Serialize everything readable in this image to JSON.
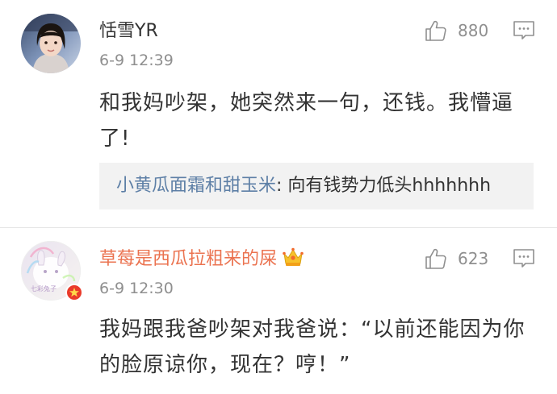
{
  "comments": [
    {
      "username": "恬雪YR",
      "time": "6-9 12:39",
      "likes": "880",
      "text": "和我妈吵架，她突然来一句，还钱。我懵逼了!",
      "reply": {
        "name": "小黄瓜面霜和甜玉米",
        "separator": ": ",
        "text": "向有钱势力低头hhhhhhh"
      }
    },
    {
      "username": "草莓是西瓜拉粗来的屎",
      "time": "6-9 12:30",
      "likes": "623",
      "text": "我妈跟我爸吵架对我爸说：“以前还能因为你的脸原谅你，现在？哼！”",
      "badge": "crown-icon",
      "avatar_text": "七彩兔子"
    }
  ],
  "colors": {
    "username_vip": "#eb7350",
    "reply_name": "#5d7fa6",
    "meta": "#8f8f8f",
    "reply_bg": "#f2f2f2"
  }
}
